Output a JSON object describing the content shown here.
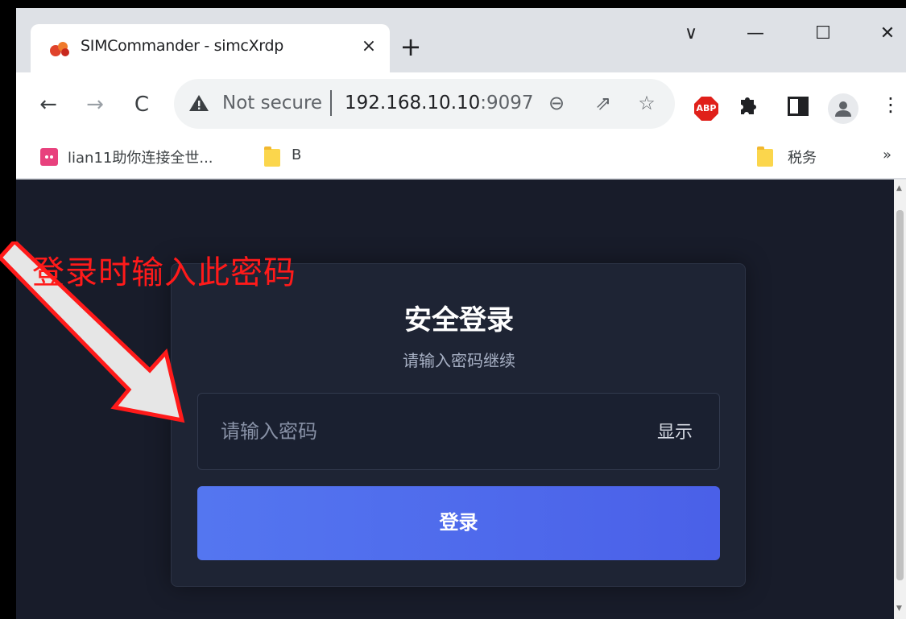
{
  "browser": {
    "tab": {
      "title": "SIMCommander - simcXrdp",
      "close": "×"
    },
    "new_tab": "+",
    "window_controls": {
      "dropdown": "∨",
      "minimize": "—",
      "maximize": "☐",
      "close": "✕"
    },
    "nav": {
      "back": "←",
      "forward": "→",
      "reload": "C"
    },
    "omnibox": {
      "security_label": "Not secure",
      "url_host": "192.168.10.10",
      "url_port": ":9097"
    },
    "toolbar_icons": {
      "zoom": "⊖",
      "share": "⇗",
      "bookmark": "☆",
      "abp": "ABP",
      "menu": "⋮"
    },
    "bookmarks": [
      {
        "label": "lian11助你连接全世..."
      },
      {
        "label": "B"
      },
      {
        "label": "税务"
      }
    ],
    "bookmarks_overflow": "»"
  },
  "login_card": {
    "title": "安全登录",
    "subtitle": "请输入密码继续",
    "password_placeholder": "请输入密码",
    "show_label": "显示",
    "login_button": "登录"
  },
  "annotation": {
    "text": "登录时输入此密码",
    "color": "#ff1a1a"
  },
  "colors": {
    "page_bg": "#181c2a",
    "card_bg": "#1e2434",
    "button_bg": "#5476f0"
  }
}
